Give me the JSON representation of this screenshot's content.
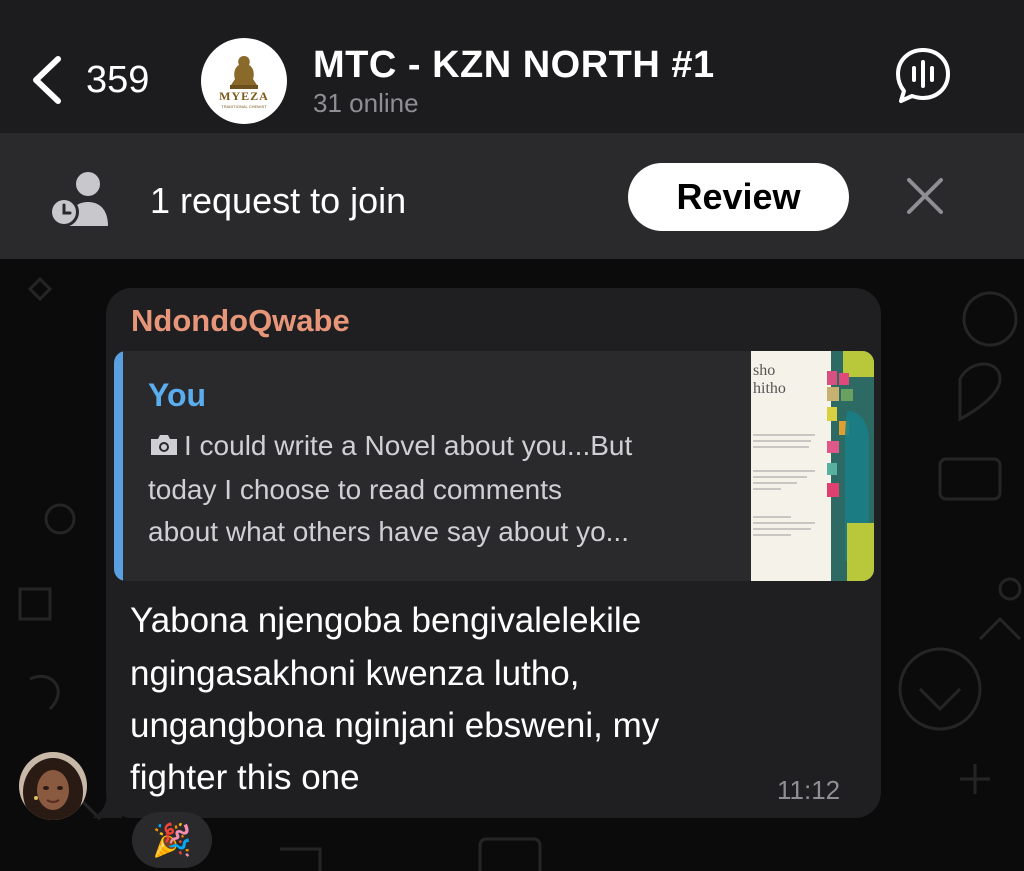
{
  "header": {
    "back_count": "359",
    "title": "MTC - KZN NORTH #1",
    "subtitle": "31 online",
    "avatar_logo_text": "MYEZA",
    "avatar_logo_subtext": "TRADITIONAL CHEMIST"
  },
  "banner": {
    "text": "1 request to join",
    "review_label": "Review"
  },
  "message": {
    "sender": "NdondoQwabe",
    "sender_color": "#e8967a",
    "reply": {
      "name": "You",
      "name_color": "#5aaef0",
      "lines": [
        "I could write a Novel about you...But",
        "today I choose to read comments",
        "about what others have say about yo..."
      ]
    },
    "lines": [
      "Yabona njengoba bengivalelekile",
      "ngingasakhoni kwenza lutho,",
      "ungangbona nginjani ebsweni, my",
      "fighter this one"
    ],
    "time": "11:12",
    "reaction": "🎉"
  }
}
